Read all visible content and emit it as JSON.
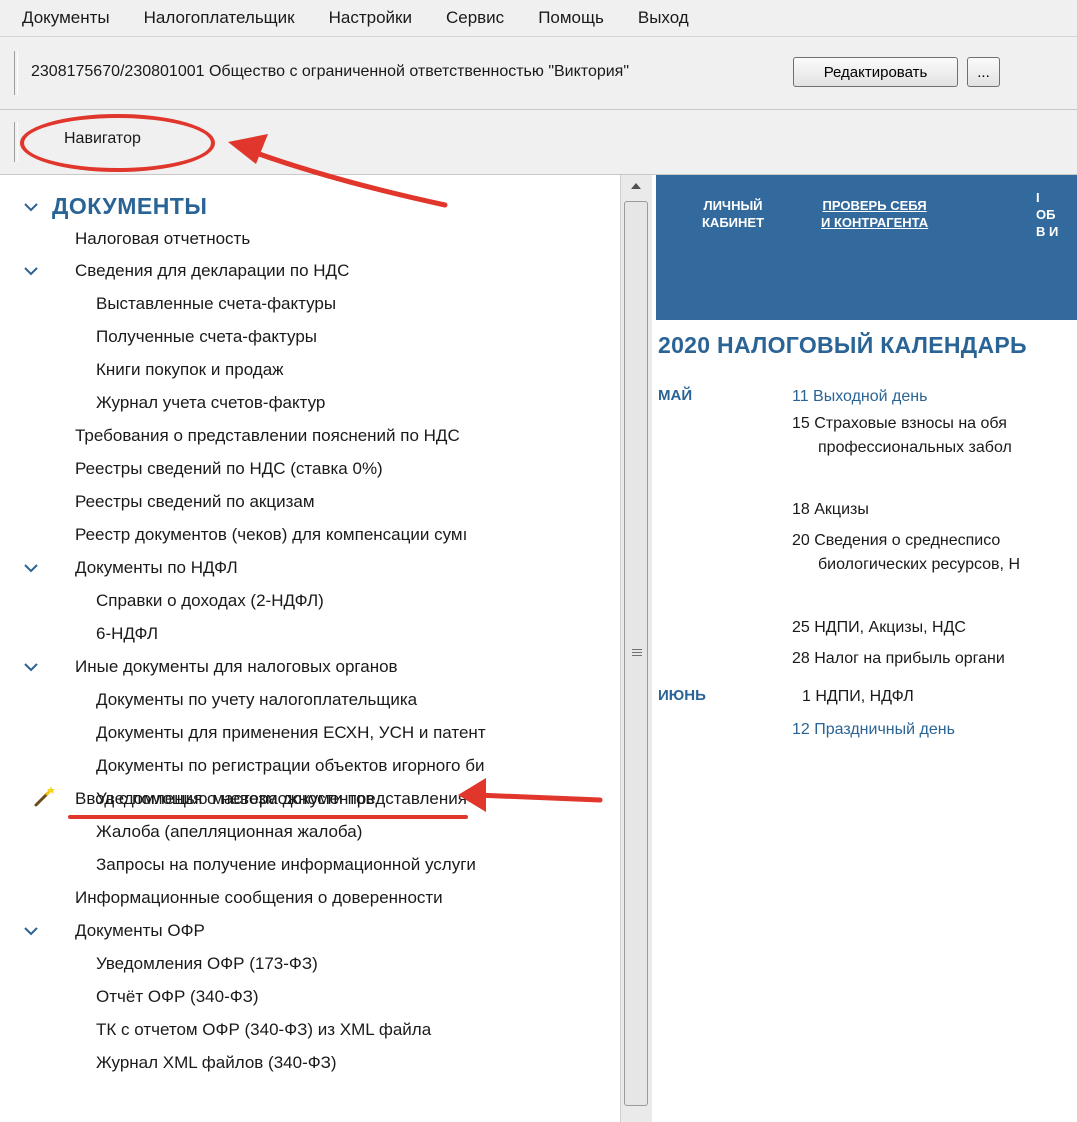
{
  "menubar": {
    "items": [
      "Документы",
      "Налогоплательщик",
      "Настройки",
      "Сервис",
      "Помощь",
      "Выход"
    ]
  },
  "orgbar": {
    "org_text": "2308175670/230801001 Общество с ограниченной ответственностью \"Виктория\"",
    "edit_button": "Редактировать",
    "more_button": "..."
  },
  "navbar": {
    "tab": "Навигатор"
  },
  "tree": {
    "root": "ДОКУМЕНТЫ",
    "items": [
      "Налоговая отчетность",
      "Сведения для декларации по НДС",
      "Выставленные счета-фактуры",
      "Полученные счета-фактуры",
      "Книги покупок и продаж",
      "Журнал учета счетов-фактур",
      "Требования о представлении пояснений по НДС",
      "Реестры сведений по НДС (ставка 0%)",
      "Реестры сведений по акцизам",
      "Реестр документов (чеков) для компенсации сумı",
      "Документы по НДФЛ",
      "Справки о доходах (2-НДФЛ)",
      "6-НДФЛ",
      "Иные документы для налоговых органов",
      "Документы по учету налогоплательщика",
      "Документы для применения ЕСХН, УСН и патент",
      "Документы по регистрации объектов игорного би",
      "Уведомления о невозможности представления в",
      "Жалоба (апелляционная жалоба)",
      "Запросы на получение информационной услуги",
      "Информационные сообщения о доверенности",
      "Документы ОФР",
      "Уведомления ОФР (173-ФЗ)",
      "Отчёт ОФР (340-ФЗ)",
      "ТК с отчетом ОФР (340-ФЗ) из XML файла",
      "Журнал XML файлов (340-ФЗ)",
      "Ввод с помощью мастера документов"
    ]
  },
  "banner": {
    "b1_line1": "ЛИЧНЫЙ",
    "b1_line2": "КАБИНЕТ",
    "b2_line1": "ПРОВЕРЬ СЕБЯ",
    "b2_line2": "И КОНТРАГЕНТА",
    "b3_line1": "I",
    "b3_line2": "ОБ",
    "b3_line3": "В И"
  },
  "calendar": {
    "title": "2020  НАЛОГОВЫЙ КАЛЕНДАРЬ",
    "months": [
      "МАЙ",
      "ИЮНЬ"
    ],
    "events": [
      "11  Выходной день",
      "15  Страховые взносы на обя",
      "профессиональных забол",
      "18  Акцизы",
      "20  Сведения о среднесписо",
      "биологических ресурсов, Н",
      "25  НДПИ, Акцизы, НДС",
      "28  Налог на прибыль органи",
      "1  НДПИ, НДФЛ",
      "12  Праздничный день"
    ]
  },
  "colors": {
    "accent_blue": "#2a6496",
    "banner_blue": "#336a9e",
    "annotation_red": "#e0362c"
  }
}
